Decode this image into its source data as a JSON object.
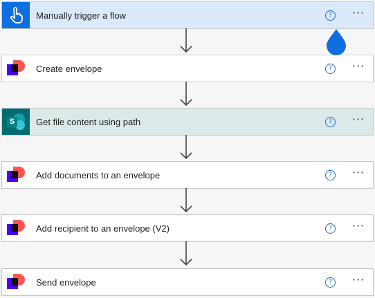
{
  "flow": {
    "steps": [
      {
        "title": "Manually trigger a flow",
        "icon": "touch-icon",
        "kind": "trigger",
        "help_glyph": "?",
        "more_glyph": "···"
      },
      {
        "title": "Create envelope",
        "icon": "docusign-icon",
        "kind": "docusign",
        "help_glyph": "?",
        "more_glyph": "···"
      },
      {
        "title": "Get file content using path",
        "icon": "sharepoint-icon",
        "kind": "sharepoint",
        "help_glyph": "?",
        "more_glyph": "···"
      },
      {
        "title": "Add documents to an envelope",
        "icon": "docusign-icon",
        "kind": "docusign",
        "help_glyph": "?",
        "more_glyph": "···"
      },
      {
        "title": "Add recipient to an envelope (V2)",
        "icon": "docusign-icon",
        "kind": "docusign",
        "help_glyph": "?",
        "more_glyph": "···"
      },
      {
        "title": "Send envelope",
        "icon": "docusign-icon",
        "kind": "docusign",
        "help_glyph": "?",
        "more_glyph": "···"
      }
    ],
    "sharepoint_letter": "S"
  },
  "colors": {
    "trigger_bg": "#dbe9fb",
    "trigger_icon_bg": "#0f6fe0",
    "sharepoint_bg": "#dbe9e9",
    "sharepoint_icon_bg": "#036c70",
    "card_bg": "#ffffff",
    "help_blue": "#1f6fd0",
    "droplet_blue": "#0f6fe0"
  }
}
